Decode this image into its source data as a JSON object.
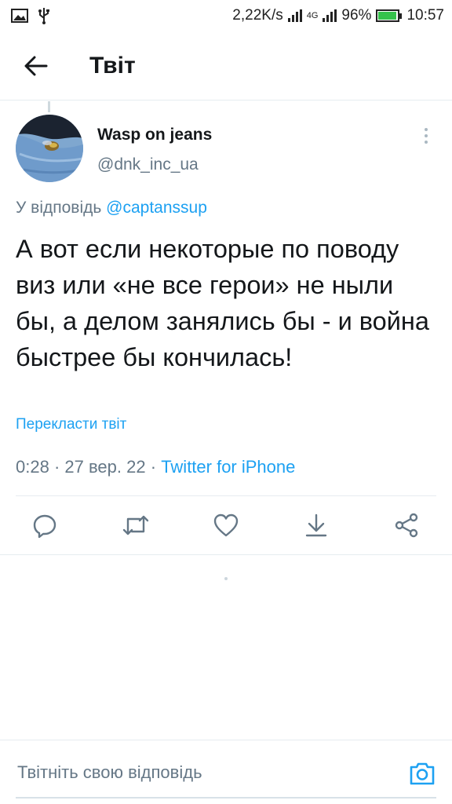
{
  "status_bar": {
    "net_speed": "2,22K/s",
    "network": "4G",
    "battery": "96%",
    "battery_level": 0.96,
    "time": "10:57"
  },
  "header": {
    "title": "Твіт"
  },
  "tweet": {
    "author_name": "Wasp on jeans",
    "author_handle": "@dnk_inc_ua",
    "reply_prefix": "У відповідь",
    "reply_to": "@captanssup",
    "text": "А вот если некоторые по поводу виз или «не все герои» не ныли бы, а делом занялись бы - и война быстрее бы кончилась!",
    "translate_label": "Перекласти твіт",
    "time": "0:28",
    "date": "27 вер. 22",
    "source": "Twitter for iPhone",
    "sep": "·"
  },
  "actions": [
    {
      "icon": "reply-icon"
    },
    {
      "icon": "retweet-icon"
    },
    {
      "icon": "like-icon"
    },
    {
      "icon": "download-icon"
    },
    {
      "icon": "share-icon"
    }
  ],
  "composer": {
    "placeholder": "Твітніть свою відповідь",
    "camera_icon": "camera-icon"
  },
  "colors": {
    "accent": "#1da1f2",
    "text": "#14171a",
    "secondary": "#657786",
    "icon": "#657786",
    "battery_fill": "#35c24b"
  }
}
